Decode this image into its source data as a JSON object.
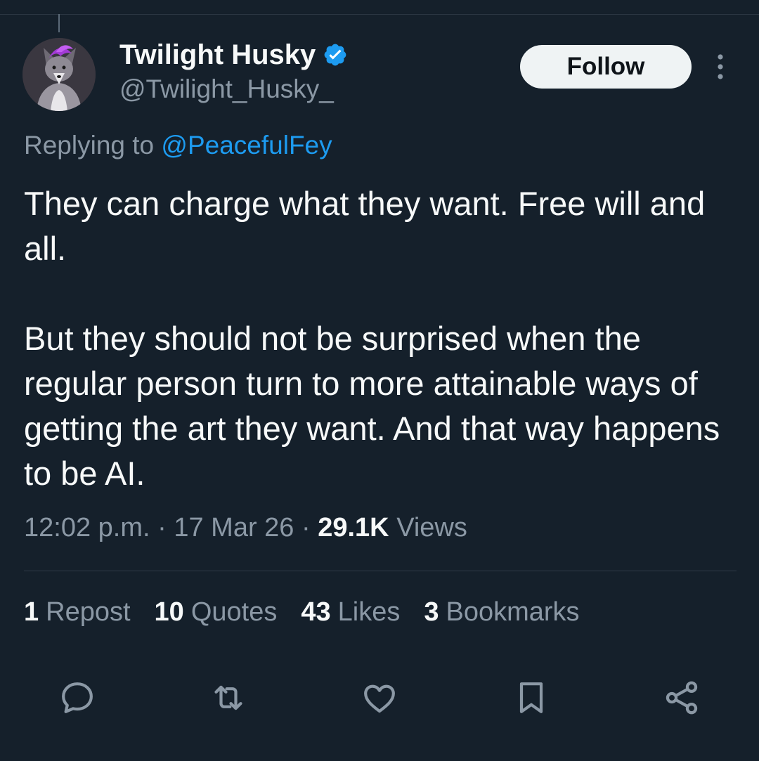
{
  "author": {
    "display_name": "Twilight Husky",
    "handle": "@Twilight_Husky_",
    "verified": true,
    "verified_color": "#1d9bf0"
  },
  "follow_label": "Follow",
  "reply": {
    "prefix": "Replying to",
    "mention": "@PeacefulFey"
  },
  "tweet": {
    "paragraphs": [
      "They can charge what they want. Free will and all.",
      "But they should not be surprised when the regular person turn to more attainable ways of getting the art they want. And that way happens to be AI."
    ]
  },
  "meta": {
    "time": "12:02 p.m.",
    "separator": "·",
    "date": "17 Mar 26",
    "views_count": "29.1K",
    "views_label": "Views"
  },
  "stats": [
    {
      "count": "1",
      "label": "Repost"
    },
    {
      "count": "10",
      "label": "Quotes"
    },
    {
      "count": "43",
      "label": "Likes"
    },
    {
      "count": "3",
      "label": "Bookmarks"
    }
  ],
  "actions": [
    "reply-icon",
    "repost-icon",
    "like-icon",
    "bookmark-icon",
    "share-icon"
  ],
  "colors": {
    "background": "#15202b",
    "primary_text": "#f7f9f9",
    "secondary_text": "#8b98a5",
    "accent": "#1d9bf0"
  }
}
